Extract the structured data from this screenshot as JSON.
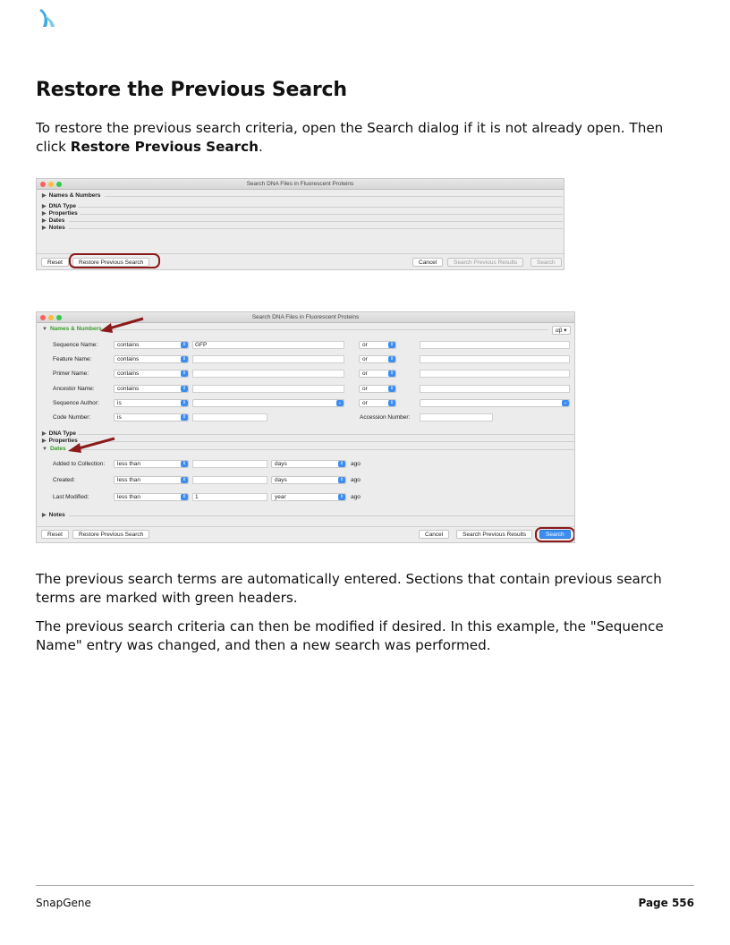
{
  "heading": "Restore the Previous Search",
  "intro_text": "To restore the previous search criteria, open the Search dialog if it is not already open. Then click ",
  "intro_bold": "Restore Previous Search",
  "intro_end": ".",
  "dialog1": {
    "title": "Search DNA Files in Fluorescent Proteins",
    "sections": [
      "Names & Numbers",
      "DNA Type",
      "Properties",
      "Dates",
      "Notes"
    ],
    "buttons": {
      "reset": "Reset",
      "restore": "Restore Previous Search",
      "cancel": "Cancel",
      "search_previous": "Search Previous Results",
      "search": "Search"
    }
  },
  "dialog2": {
    "title": "Search DNA Files in Fluorescent Proteins",
    "sections": {
      "names": "Names & Numbers",
      "dna": "DNA Type",
      "props": "Properties",
      "dates": "Dates",
      "notes": "Notes"
    },
    "alpha_btn": "αβ ▾",
    "rows": [
      {
        "label": "Sequence Name:",
        "op": "contains",
        "value": "GFP",
        "join": "or"
      },
      {
        "label": "Feature Name:",
        "op": "contains",
        "value": "",
        "join": "or"
      },
      {
        "label": "Primer Name:",
        "op": "contains",
        "value": "",
        "join": "or"
      },
      {
        "label": "Ancestor Name:",
        "op": "contains",
        "value": "",
        "join": "or"
      },
      {
        "label": "Sequence Author:",
        "op": "is",
        "value": "",
        "join": "or"
      }
    ],
    "code_row": {
      "label": "Code Number:",
      "op": "is",
      "acc_label": "Accession Number:"
    },
    "dates": [
      {
        "label": "Added to Collection:",
        "op": "less than",
        "value": "",
        "unit": "days",
        "ago": "ago"
      },
      {
        "label": "Created:",
        "op": "less than",
        "value": "",
        "unit": "days",
        "ago": "ago"
      },
      {
        "label": "Last Modified:",
        "op": "less than",
        "value": "1",
        "unit": "year",
        "ago": "ago"
      }
    ],
    "buttons": {
      "reset": "Reset",
      "restore": "Restore Previous Search",
      "cancel": "Cancel",
      "search_previous": "Search Previous Results",
      "search": "Search"
    }
  },
  "para2": "The previous search terms are automatically entered. Sections that contain previous search terms are marked with green headers.",
  "para3": "The previous search criteria can then be modified if desired. In this example, the \"Sequence Name\" entry was changed, and then a new search was performed.",
  "footer": {
    "left": "SnapGene",
    "right": "Page 556"
  }
}
